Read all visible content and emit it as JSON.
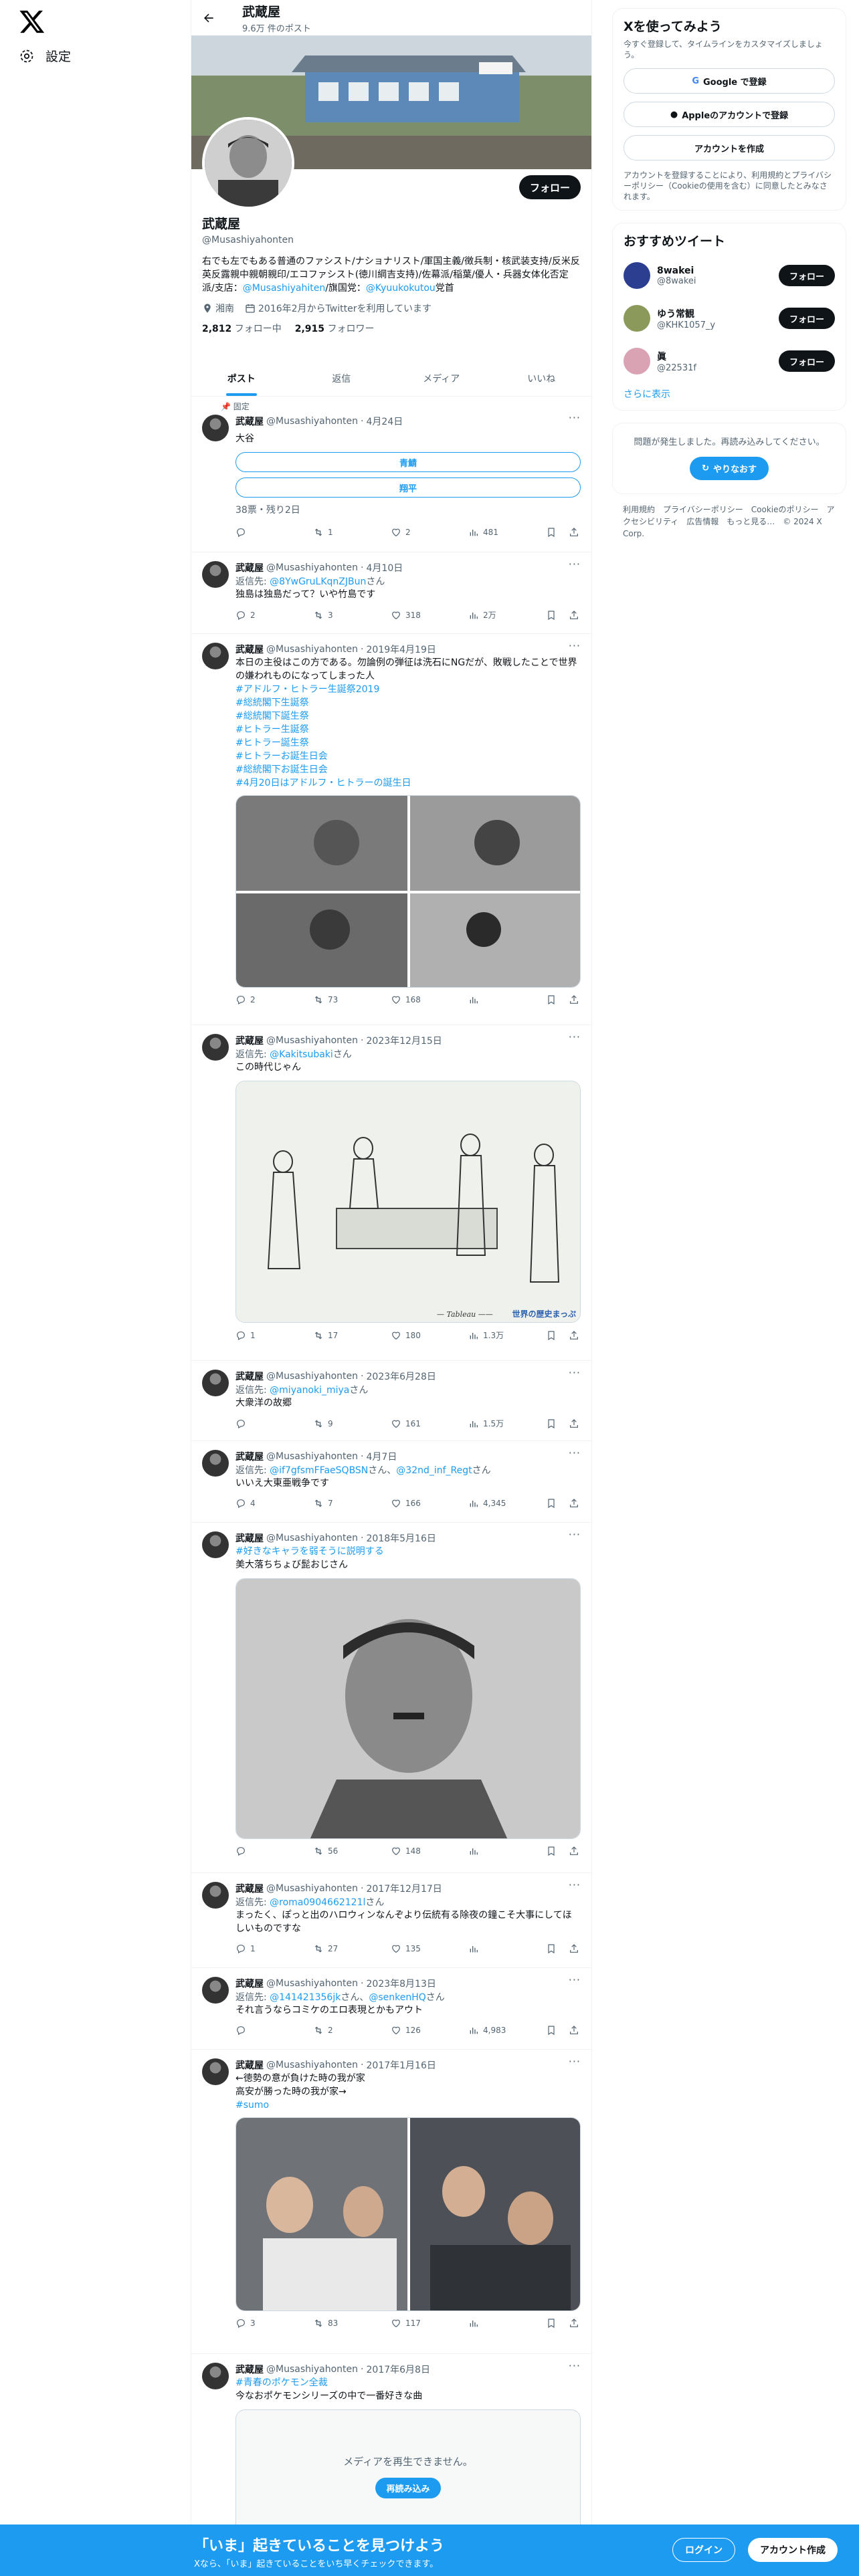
{
  "nav": {
    "settings": "設定"
  },
  "header": {
    "name": "武蔵屋",
    "post_count": "9.6万 件のポスト"
  },
  "profile": {
    "name": "武蔵屋",
    "handle": "@Musashiyahonten",
    "follow": "フォロー",
    "bio": "右でも左でもある普通のファシスト/ナショナリスト/軍国主義/徴兵制・核武装支持/反米反英反露親中親朝親印/エコファシスト(徳川綱吉支持)/佐幕派/稲葉/優人・兵器女体化否定派/支店：",
    "bio_link1": "@Musashiyahiten",
    "bio_mid": "/旗国党：",
    "bio_link2": "@Kyuukokutou",
    "bio_end": "党首",
    "location": "湘南",
    "joined": "2016年2月からTwitterを利用しています",
    "following_num": "2,812",
    "following_label": "フォロー中",
    "followers_num": "2,915",
    "followers_label": "フォロワー"
  },
  "tabs": [
    "ポスト",
    "返信",
    "メディア",
    "いいね"
  ],
  "tweets": [
    {
      "pin": "固定",
      "name": "武蔵屋",
      "handle": "@Musashiyahonten",
      "date": "4月24日",
      "text": "大谷",
      "poll": [
        "青鯖",
        "翔平"
      ],
      "poll_meta": "38票・残り2日",
      "reply": "",
      "retweet": "1",
      "like": "2",
      "views": "481"
    },
    {
      "name": "武蔵屋",
      "handle": "@Musashiyahonten",
      "date": "4月10日",
      "reply_to": "返信先:",
      "reply_handle": "@8YwGruLKqnZJBun",
      "reply_suffix": "さん",
      "text": "独島は独島だって？いや竹島です",
      "reply": "2",
      "retweet": "3",
      "like": "318",
      "views": "2万"
    },
    {
      "name": "武蔵屋",
      "handle": "@Musashiyahonten",
      "date": "2019年4月19日",
      "text": "本日の主役はこの方である。勿論例の弾征は洗石にNGだが、敗戦したことで世界の嫌われものになってしまった人",
      "tags": [
        "#アドルフ・ヒトラー生誕祭2019",
        "#総統閣下生誕祭",
        "#総統閣下誕生祭",
        "#ヒトラー生誕祭",
        "#ヒトラー誕生祭",
        "#ヒトラーお誕生日会",
        "#総統閣下お誕生日会",
        "#4月20日はアドルフ・ヒトラーの誕生日"
      ],
      "reply": "2",
      "retweet": "73",
      "like": "168",
      "views": ""
    },
    {
      "name": "武蔵屋",
      "handle": "@Musashiyahonten",
      "date": "2023年12月15日",
      "reply_to": "返信先:",
      "reply_handle": "@Kakitsubaki",
      "reply_suffix": "さん",
      "text": "この時代じゃん",
      "caption": "世界の歴史まっぷ",
      "reply": "1",
      "retweet": "17",
      "like": "180",
      "views": "1.3万"
    },
    {
      "name": "武蔵屋",
      "handle": "@Musashiyahonten",
      "date": "2023年6月28日",
      "reply_to": "返信先:",
      "reply_handle": "@miyanoki_miya",
      "reply_suffix": "さん",
      "text": "大衆洋の故郷",
      "reply": "",
      "retweet": "9",
      "like": "161",
      "views": "1.5万"
    },
    {
      "name": "武蔵屋",
      "handle": "@Musashiyahonten",
      "date": "4月7日",
      "reply_to": "返信先:",
      "reply_handle": "@if7gfsmFFaeSQBSN",
      "reply_mid": "さん、",
      "reply_handle2": "@32nd_inf_Regt",
      "reply_suffix": "さん",
      "text": "いいえ大東亜戦争です",
      "reply": "4",
      "retweet": "7",
      "like": "166",
      "views": "4,345"
    },
    {
      "name": "武蔵屋",
      "handle": "@Musashiyahonten",
      "date": "2018年5月16日",
      "tag": "#好きなキャラを弱そうに説明する",
      "text": "美大落ちちょび髭おじさん",
      "reply": "",
      "retweet": "56",
      "like": "148",
      "views": ""
    },
    {
      "name": "武蔵屋",
      "handle": "@Musashiyahonten",
      "date": "2017年12月17日",
      "reply_to": "返信先:",
      "reply_handle": "@roma0904662121l",
      "reply_suffix": "さん",
      "text": "まったく、ぽっと出のハロウィンなんぞより伝統有る除夜の鐘こそ大事にしてほしいものですな",
      "reply": "1",
      "retweet": "27",
      "like": "135",
      "views": ""
    },
    {
      "name": "武蔵屋",
      "handle": "@Musashiyahonten",
      "date": "2023年8月13日",
      "reply_to": "返信先:",
      "reply_handle": "@141421356jk",
      "reply_mid": "さん、",
      "reply_handle2": "@senkenHQ",
      "reply_suffix": "さん",
      "text": "それ言うならコミケのエロ表現とかもアウト",
      "reply": "",
      "retweet": "2",
      "like": "126",
      "views": "4,983"
    },
    {
      "name": "武蔵屋",
      "handle": "@Musashiyahonten",
      "date": "2017年1月16日",
      "text": "←徳勢の意が負けた時の我が家\n高安が勝った時の我が家→",
      "tag": "#sumo",
      "reply": "3",
      "retweet": "83",
      "like": "117",
      "views": ""
    },
    {
      "name": "武蔵屋",
      "handle": "@Musashiyahonten",
      "date": "2017年6月8日",
      "tag": "#青春のポケモン全裁",
      "text": "今なおポケモンシリーズの中で一番好きな曲",
      "media_error": "メディアを再生できません。",
      "retry": "再読み込み"
    }
  ],
  "right": {
    "signup_title": "Xを使ってみよう",
    "signup_sub": "今すぐ登録して、タイムラインをカスタマイズしましょう。",
    "google": "Google で登録",
    "apple": "Appleのアカウントで登録",
    "create": "アカウントを作成",
    "terms": "アカウントを登録することにより、利用規約とプライバシーポリシー（Cookieの使用を含む）に同意したとみなされます。",
    "rec_title": "おすすめツイート",
    "recs": [
      {
        "name": "8wakei",
        "handle": "@8wakei",
        "follow": "フォロー"
      },
      {
        "name": "ゆう常観",
        "handle": "@KHK1057_y",
        "follow": "フォロー"
      },
      {
        "name": "眞",
        "handle": "@22531f",
        "follow": "フォロー"
      }
    ],
    "show_more": "さらに表示",
    "error": "問題が発生しました。再読み込みしてください。",
    "retry": "やりなおす",
    "footer": "利用規約　プライバシーポリシー　Cookieのポリシー　アクセシビリティ　広告情報　もっと見る…　© 2024 X Corp."
  },
  "bottom": {
    "title": "「いま」起きていることを見つけよう",
    "sub": "Xなら、「いま」起きていることをいち早くチェックできます。",
    "login": "ログイン",
    "signup": "アカウント作成"
  }
}
